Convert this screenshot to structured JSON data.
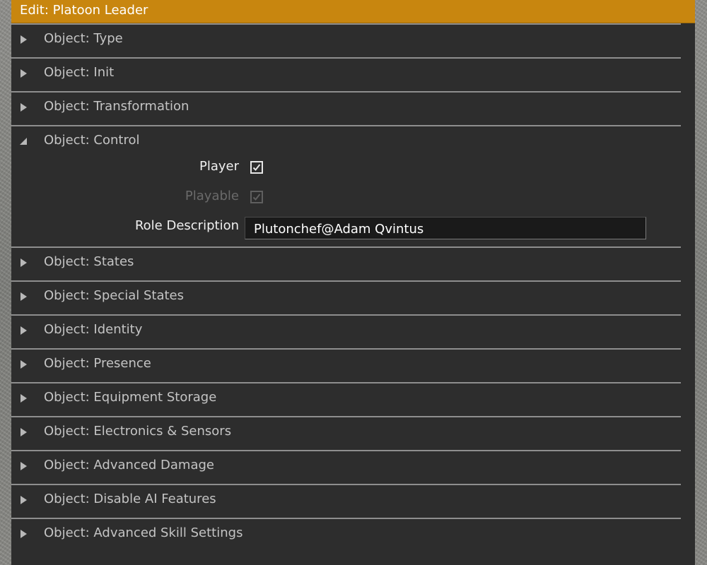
{
  "window": {
    "title": "Edit: Platoon Leader"
  },
  "sections": {
    "type": {
      "label": "Object: Type",
      "expanded": false
    },
    "init": {
      "label": "Object: Init",
      "expanded": false
    },
    "transformation": {
      "label": "Object: Transformation",
      "expanded": false
    },
    "control": {
      "label": "Object: Control",
      "expanded": true,
      "player": {
        "label": "Player",
        "checked": true,
        "enabled": true
      },
      "playable": {
        "label": "Playable",
        "checked": true,
        "enabled": false
      },
      "role_description": {
        "label": "Role Description",
        "value": "Plutonchef@Adam Qvintus"
      }
    },
    "states": {
      "label": "Object: States",
      "expanded": false
    },
    "special_states": {
      "label": "Object: Special States",
      "expanded": false
    },
    "identity": {
      "label": "Object: Identity",
      "expanded": false
    },
    "presence": {
      "label": "Object: Presence",
      "expanded": false
    },
    "equipment_storage": {
      "label": "Object: Equipment Storage",
      "expanded": false
    },
    "electronics_sensors": {
      "label": "Object: Electronics & Sensors",
      "expanded": false
    },
    "advanced_damage": {
      "label": "Object: Advanced Damage",
      "expanded": false
    },
    "disable_ai_features": {
      "label": "Object: Disable AI Features",
      "expanded": false
    },
    "advanced_skill_settings": {
      "label": "Object: Advanced Skill Settings",
      "expanded": false
    }
  },
  "icons": {
    "collapsed_arrow": "triangle-right-icon",
    "expanded_arrow": "triangle-down-icon",
    "check": "checkmark-icon"
  },
  "colors": {
    "title_bar": "#c8860f",
    "panel": "#2d2d2d",
    "separator": "#8e8e8e",
    "section_text": "#c4c4c4",
    "field_text": "#f0f0f0",
    "disabled_text": "#6a6a6a",
    "input_bg": "#1a1a1a"
  }
}
